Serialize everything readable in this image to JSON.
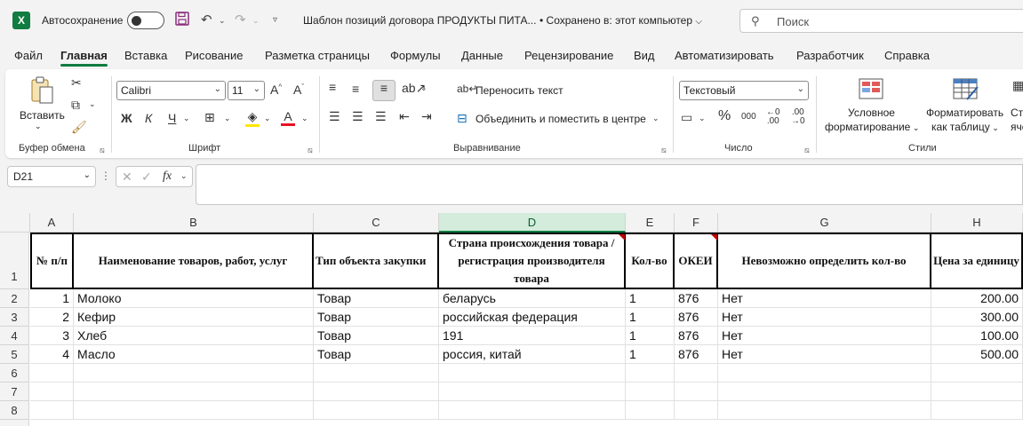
{
  "titlebar": {
    "app_logo": "X",
    "autosave_label": "Автосохранение",
    "document_title": "Шаблон позиций договора ПРОДУКТЫ ПИТА...",
    "saved_status": "• Сохранено в: этот компьютер",
    "search_placeholder": "Поиск"
  },
  "menu": {
    "tabs": [
      "Файл",
      "Главная",
      "Вставка",
      "Рисование",
      "Разметка страницы",
      "Формулы",
      "Данные",
      "Рецензирование",
      "Вид",
      "Автоматизировать",
      "Разработчик",
      "Справка"
    ],
    "active_tab": "Главная"
  },
  "ribbon": {
    "clipboard": {
      "paste_label": "Вставить",
      "group_label": "Буфер обмена"
    },
    "font": {
      "font_name": "Calibri",
      "font_size": "11",
      "bold": "Ж",
      "italic": "К",
      "underline": "Ч",
      "group_label": "Шрифт"
    },
    "alignment": {
      "wrap_text": "Переносить текст",
      "merge_center": "Объединить и поместить в центре",
      "group_label": "Выравнивание"
    },
    "number": {
      "format": "Текстовый",
      "percent": "%",
      "thousands": "000",
      "group_label": "Число"
    },
    "styles": {
      "conditional_line1": "Условное",
      "conditional_line2": "форматирование",
      "format_table_line1": "Форматировать",
      "format_table_line2": "как таблицу",
      "cell_styles_line1": "Сти",
      "cell_styles_line2": "яче",
      "group_label": "Стили"
    }
  },
  "formula_bar": {
    "name_box": "D21",
    "fx": "fx",
    "formula": ""
  },
  "sheet": {
    "columns": [
      "A",
      "B",
      "C",
      "D",
      "E",
      "F",
      "G",
      "H"
    ],
    "selected_column": "D",
    "row_numbers": [
      "1",
      "2",
      "3",
      "4",
      "5",
      "6",
      "7",
      "8"
    ],
    "headers": [
      "№ п/п",
      "Наименование товаров, работ, услуг",
      "Тип объекта закупки",
      "Страна происхождения товара / регистрация производителя товара",
      "Кол-во",
      "ОКЕИ",
      "Невозможно определить кол-во",
      "Цена за единицу"
    ],
    "rows": [
      [
        "1",
        "Молоко",
        "Товар",
        "беларусь",
        "1",
        "876",
        "Нет",
        "200.00"
      ],
      [
        "2",
        "Кефир",
        "Товар",
        "российская федерация",
        "1",
        "876",
        "Нет",
        "300.00"
      ],
      [
        "3",
        "Хлеб",
        "Товар",
        "191",
        "1",
        "876",
        "Нет",
        "100.00"
      ],
      [
        "4",
        "Масло",
        "Товар",
        "россия, китай",
        "1",
        "876",
        "Нет",
        "500.00"
      ]
    ]
  },
  "colors": {
    "accent": "#107c41",
    "selected_header": "#d3ecdc"
  }
}
